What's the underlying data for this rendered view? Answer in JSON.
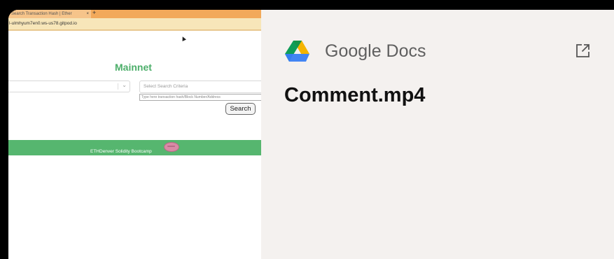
{
  "thumbnail": {
    "tab_title": "Search Transaction Hash | Ether",
    "tab_close": "×",
    "new_tab": "+",
    "url": "l-ulmhyum7en0.ws-us78.gitpod.io",
    "heading": "Mainnet",
    "select_left_chevron": "⌄",
    "search_criteria_placeholder": "Select Search Criteria",
    "tx_input_placeholder": "Type here transaction hash/Block Number/Address",
    "search_button": "Search",
    "footer_text": "ETHDenver Solidity Bootcamp"
  },
  "panel": {
    "provider": "Google Docs",
    "title": "Comment.mp4",
    "logo_icon": "google-drive-icon",
    "external_link_icon": "external-link-icon"
  },
  "colors": {
    "panel_bg": "#f4f1ef",
    "accent_green": "#56b66f",
    "drive_green": "#0f9d58",
    "drive_yellow": "#f4b400",
    "drive_blue": "#4285f4"
  }
}
